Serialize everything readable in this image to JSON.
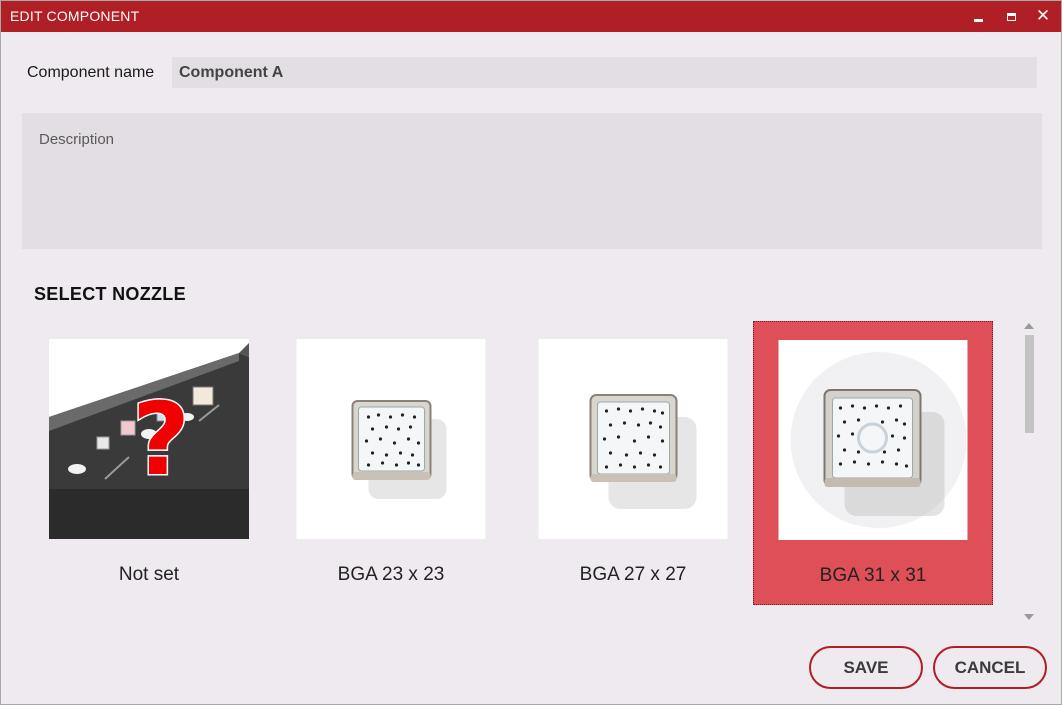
{
  "window": {
    "title": "EDIT COMPONENT",
    "minimize_icon": "minimize-icon",
    "maximize_icon": "maximize-icon",
    "close_icon": "close-icon",
    "close_glyph": "✕",
    "accent_color": "#b01e26"
  },
  "form": {
    "component_name_label": "Component name",
    "component_name_value": "Component A",
    "description_placeholder": "Description",
    "description_value": ""
  },
  "nozzle_section": {
    "title": "SELECT NOZZLE",
    "selected_index": 3,
    "selected_color": "#de4f57",
    "items": [
      {
        "label": "Not set",
        "image": "unknown-nozzle-image"
      },
      {
        "label": "BGA 23 x 23",
        "image": "bga-nozzle-image"
      },
      {
        "label": "BGA 27 x 27",
        "image": "bga-nozzle-image"
      },
      {
        "label": "BGA 31 x 31",
        "image": "bga-nozzle-image"
      }
    ]
  },
  "actions": {
    "save_label": "SAVE",
    "cancel_label": "CANCEL"
  }
}
